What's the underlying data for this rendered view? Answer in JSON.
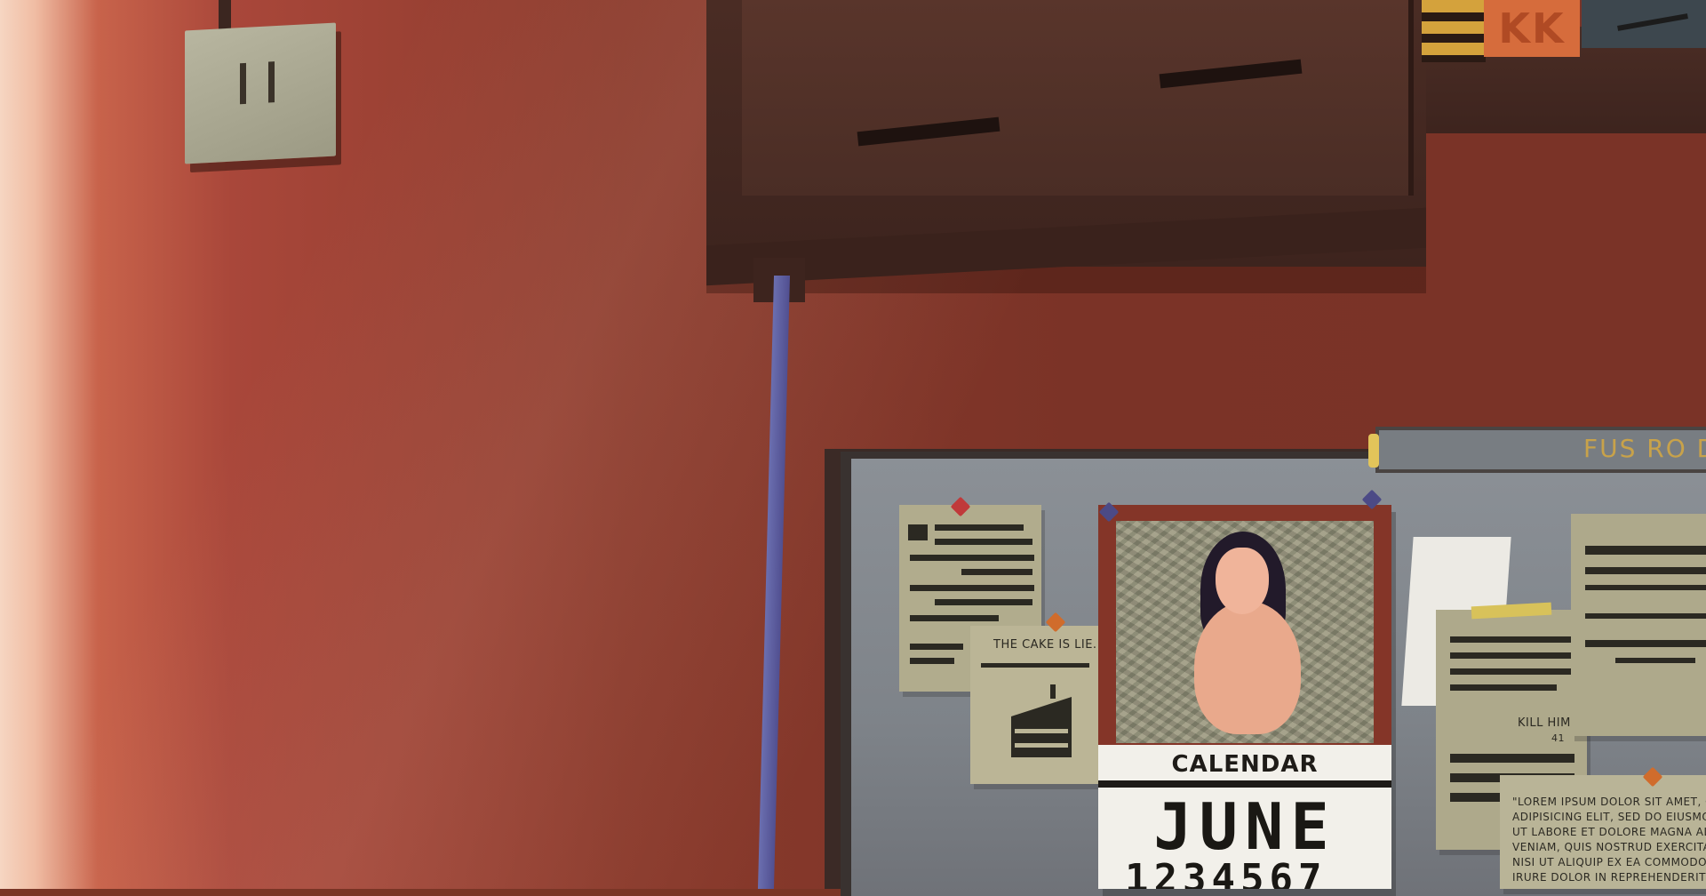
{
  "scene": {
    "colors": {
      "wall": "#7a3327",
      "board": "#848990",
      "calendar_frame": "#843528",
      "pipe": "#5e60a0",
      "label_text": "#c8a24a"
    }
  },
  "shelf": {
    "box_label": "KK"
  },
  "board": {
    "label": "FUS RO DA"
  },
  "notes": {
    "cake": "THE CAKE IS LIE.",
    "kill": "KILL HIM !",
    "kill_number": "41",
    "lorem": "\"LOREM IPSUM DOLOR SIT AMET, CONS\nADIPISICING ELIT, SED DO EIUSMOD TE\nUT LABORE ET DOLORE MAGNA ALIQUA.\nVENIAM, QUIS NOSTRUD EXERCITATION\nNISI UT ALIQUIP EX EA COMMODO CONS\nIRURE DOLOR IN REPREHENDERIT IN V"
  },
  "calendar": {
    "title": "CALENDAR",
    "month": "JUNE",
    "days": "1234567"
  }
}
